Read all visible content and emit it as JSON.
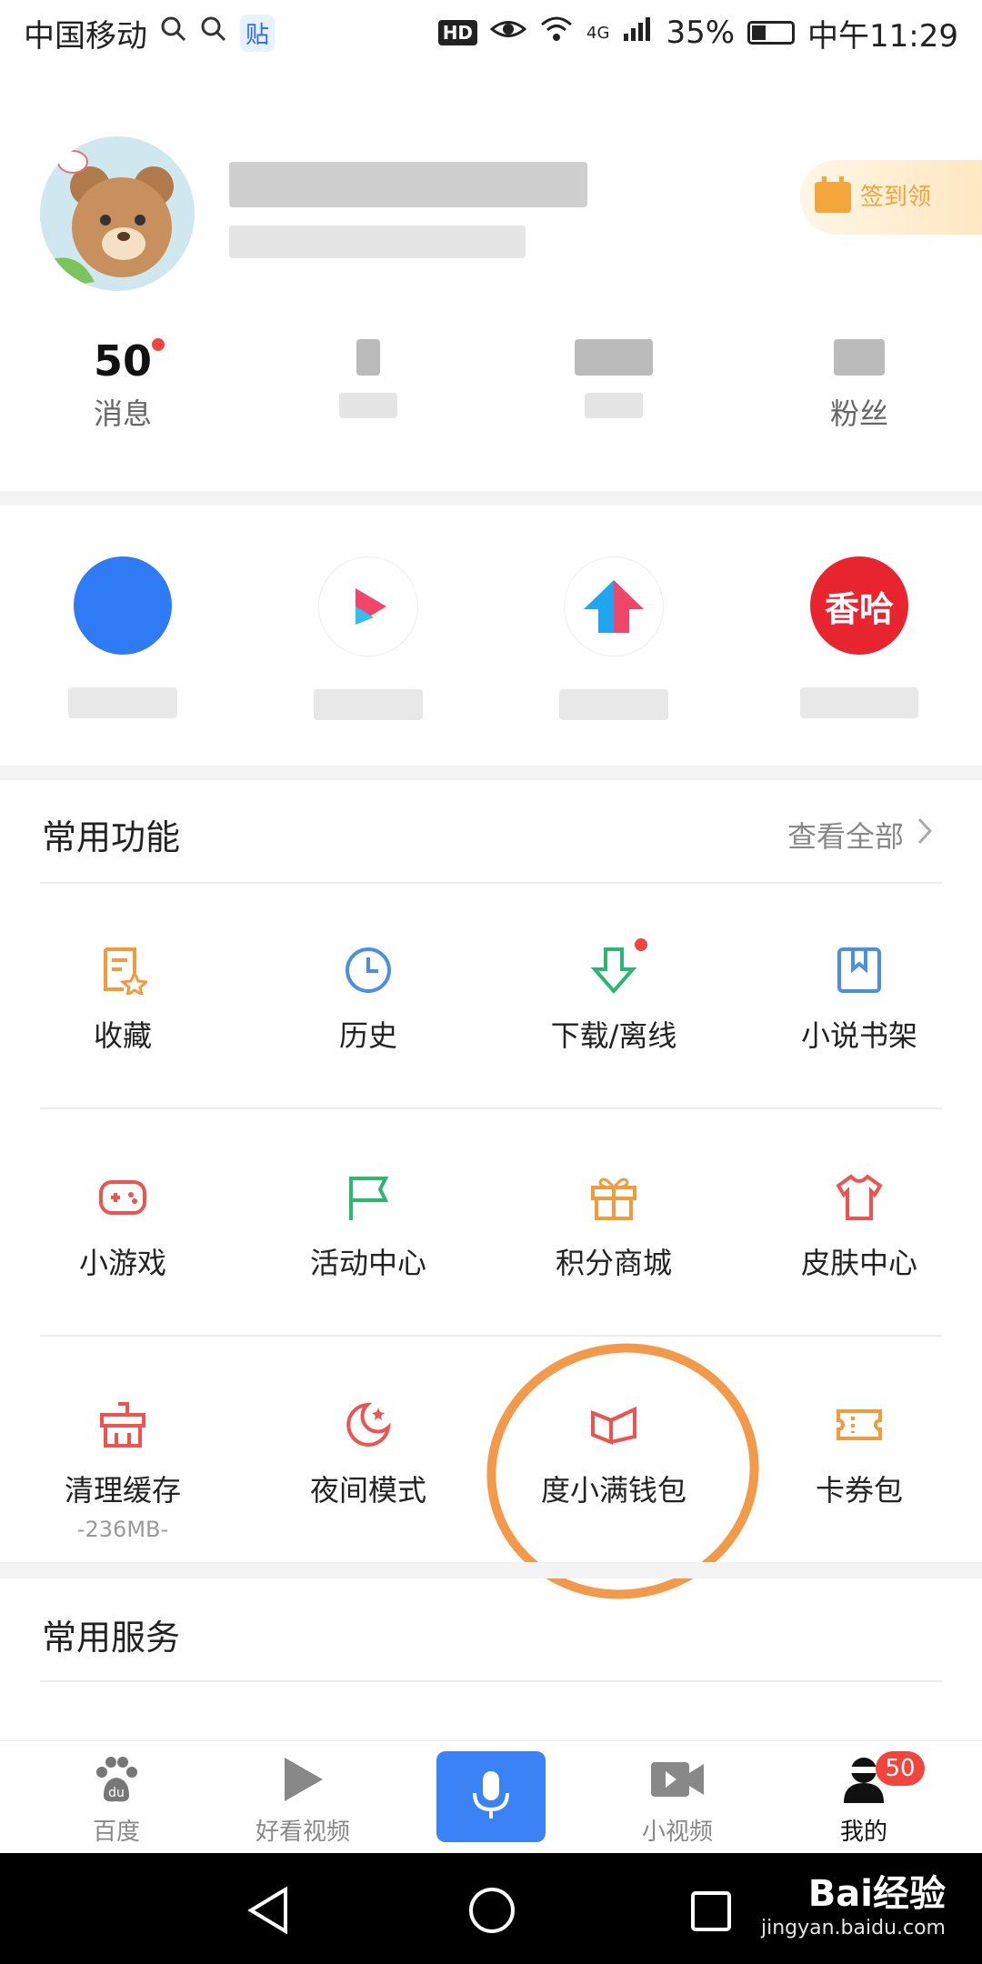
{
  "status_bar": {
    "carrier": "中国移动",
    "app_badge": "贴",
    "hd": "HD",
    "network": "4G",
    "battery": "35%",
    "battery_level": 0.35,
    "time": "中午11:29"
  },
  "profile": {
    "signin_label": "签到领",
    "stats": [
      {
        "value": "50",
        "label": "消息",
        "has_dot": true
      },
      {
        "value": "",
        "label": ""
      },
      {
        "value": "",
        "label": ""
      },
      {
        "value": "",
        "label": "粉丝"
      }
    ]
  },
  "mini_apps": [
    {
      "icon_text": "",
      "color": "#2f7bf5"
    },
    {
      "icon_text": "",
      "color": "#ffffff"
    },
    {
      "icon_text": "",
      "color": "#ffffff"
    },
    {
      "icon_text": "香哈",
      "color": "#e8242f"
    }
  ],
  "common_functions": {
    "title": "常用功能",
    "view_all": "查看全部",
    "items": [
      {
        "label": "收藏",
        "icon": "bookmark-star-icon",
        "color": "#f39a3d"
      },
      {
        "label": "历史",
        "icon": "clock-icon",
        "color": "#4a90e2"
      },
      {
        "label": "下载/离线",
        "icon": "download-icon",
        "color": "#2bb673",
        "has_dot": true
      },
      {
        "label": "小说书架",
        "icon": "book-icon",
        "color": "#4a90e2"
      },
      {
        "label": "小游戏",
        "icon": "gamepad-icon",
        "color": "#ef5350"
      },
      {
        "label": "活动中心",
        "icon": "flag-icon",
        "color": "#2bb673"
      },
      {
        "label": "积分商城",
        "icon": "gift-icon",
        "color": "#f39a3d"
      },
      {
        "label": "皮肤中心",
        "icon": "shirt-icon",
        "color": "#ef5350"
      },
      {
        "label": "清理缓存",
        "sub": "-236MB-",
        "icon": "broom-icon",
        "color": "#ef5350"
      },
      {
        "label": "夜间模式",
        "icon": "moon-icon",
        "color": "#ef5350"
      },
      {
        "label": "度小满钱包",
        "icon": "wallet-icon",
        "color": "#ef5350"
      },
      {
        "label": "卡券包",
        "icon": "coupon-icon",
        "color": "#f39a3d"
      }
    ]
  },
  "common_services": {
    "title": "常用服务"
  },
  "bottom_nav": [
    {
      "label": "百度",
      "icon": "baidu-paw-icon"
    },
    {
      "label": "好看视频",
      "icon": "play-icon"
    },
    {
      "label": "",
      "icon": "microphone-icon"
    },
    {
      "label": "小视频",
      "icon": "video-camera-icon"
    },
    {
      "label": "我的",
      "icon": "user-icon",
      "badge": "50"
    }
  ],
  "watermark": {
    "brand": "Bai经验",
    "url": "jingyan.baidu.com"
  }
}
